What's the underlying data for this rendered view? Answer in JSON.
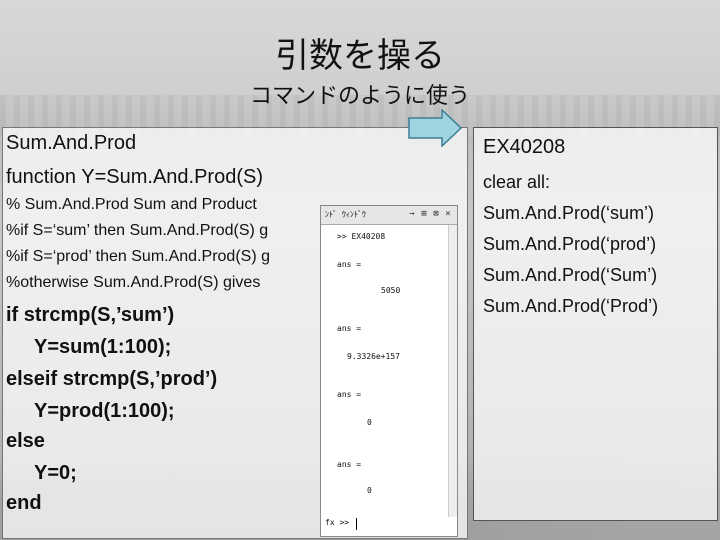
{
  "slide": {
    "title": "引数を操る",
    "subtitle": "コマンドのように使う"
  },
  "left_panel": {
    "heading_lines": [
      "Sum.And.Prod",
      "function Y=Sum.And.Prod(S)"
    ],
    "comment_lines": [
      "% Sum.And.Prod Sum and Product",
      "%if S=‘sum’ then Sum.And.Prod(S) g",
      "%if S=‘prod’ then Sum.And.Prod(S) g",
      "%otherwise Sum.And.Prod(S) gives"
    ],
    "code_lines": [
      "if strcmp(S,’sum’)",
      "  Y=sum(1:100);",
      "elseif strcmp(S,’prod’)",
      "  Y=prod(1:100);",
      "else",
      "  Y=0;",
      "end"
    ]
  },
  "command_window": {
    "title": "ﾝﾄﾞ ｳｨﾝﾄﾞｳ",
    "buttons": [
      "→",
      "⊞",
      "⊠",
      "×"
    ],
    "command": ">> EX40208",
    "results": [
      {
        "label": "ans =",
        "value": "5050"
      },
      {
        "label": "ans =",
        "value": "9.3326e+157"
      },
      {
        "label": "ans =",
        "value": "0"
      },
      {
        "label": "ans =",
        "value": "0"
      }
    ],
    "prompt": "fx >>"
  },
  "right_panel": {
    "lines": [
      "EX40208",
      "clear all:",
      "Sum.And.Prod(‘sum’)",
      "Sum.And.Prod(‘prod’)",
      "Sum.And.Prod(‘Sum’)",
      "Sum.And.Prod(‘Prod’)"
    ]
  },
  "colors": {
    "arrow_fill": "#9fd3e0",
    "arrow_stroke": "#3a7f95"
  }
}
